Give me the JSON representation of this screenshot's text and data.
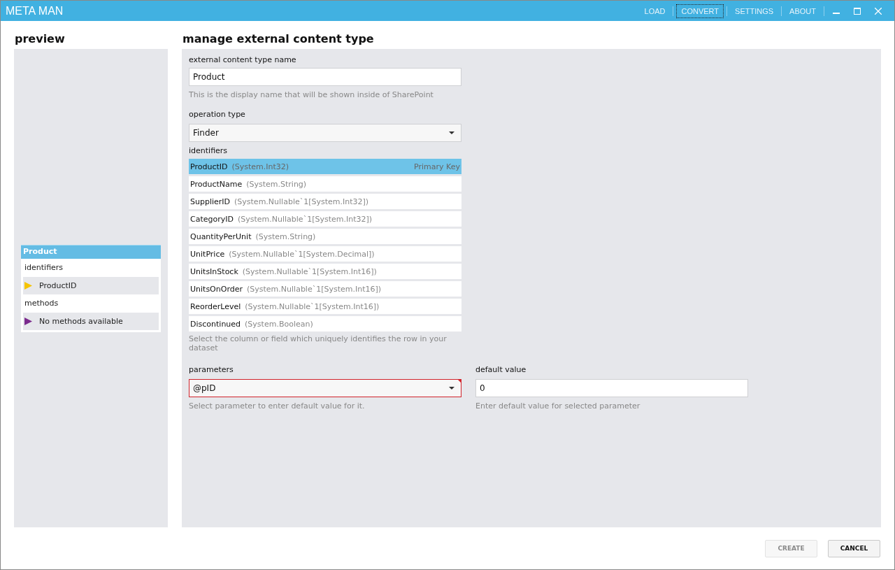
{
  "window": {
    "title": "META MAN",
    "menu": [
      {
        "label": "LOAD",
        "focused": false
      },
      {
        "label": "CONVERT",
        "focused": true
      },
      {
        "label": "SETTINGS",
        "focused": false
      },
      {
        "label": "ABOUT",
        "focused": false
      }
    ]
  },
  "preview": {
    "title": "preview",
    "card": {
      "title": "Product",
      "sections": [
        {
          "label": "identifiers",
          "items": [
            {
              "text": "ProductID",
              "color": "#f5c400"
            }
          ]
        },
        {
          "label": "methods",
          "items": [
            {
              "text": "No methods available",
              "color": "#7b2b8e"
            }
          ]
        }
      ]
    }
  },
  "main": {
    "title": "manage external content type",
    "name_field": {
      "label": "external content type name",
      "value": "Product",
      "hint": "This is the display name that will be shown inside of SharePoint"
    },
    "operation_type": {
      "label": "operation type",
      "value": "Finder"
    },
    "identifiers": {
      "label": "identifiers",
      "hint": "Select the column or field which uniquely identifies the row in your dataset",
      "rows": [
        {
          "name": "ProductID",
          "type": "(System.Int32)",
          "badge": "Primary Key",
          "selected": true
        },
        {
          "name": "ProductName",
          "type": "(System.String)",
          "selected": false
        },
        {
          "name": "SupplierID",
          "type": "(System.Nullable`1[System.Int32])",
          "selected": false
        },
        {
          "name": "CategoryID",
          "type": "(System.Nullable`1[System.Int32])",
          "selected": false
        },
        {
          "name": "QuantityPerUnit",
          "type": "(System.String)",
          "selected": false
        },
        {
          "name": "UnitPrice",
          "type": "(System.Nullable`1[System.Decimal])",
          "selected": false
        },
        {
          "name": "UnitsInStock",
          "type": "(System.Nullable`1[System.Int16])",
          "selected": false
        },
        {
          "name": "UnitsOnOrder",
          "type": "(System.Nullable`1[System.Int16])",
          "selected": false
        },
        {
          "name": "ReorderLevel",
          "type": "(System.Nullable`1[System.Int16])",
          "selected": false
        },
        {
          "name": "Discontinued",
          "type": "(System.Boolean)",
          "selected": false
        }
      ]
    },
    "parameters": {
      "label": "parameters",
      "value": "@pID",
      "invalid": true,
      "hint": "Select parameter to enter default value for it."
    },
    "default_value": {
      "label": "default value",
      "value": "0",
      "hint": "Enter default value for selected parameter"
    }
  },
  "buttons": [
    {
      "label": "CREATE",
      "disabled": true
    },
    {
      "label": "CANCEL",
      "disabled": false
    }
  ]
}
